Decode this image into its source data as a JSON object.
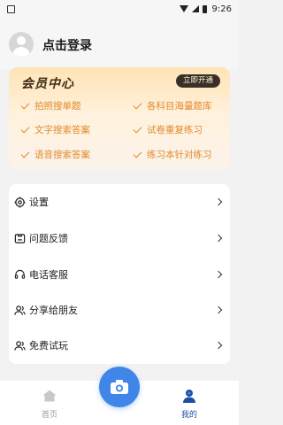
{
  "status_bar": {
    "app_icon": "a-notification-icon",
    "time": "9:26"
  },
  "header": {
    "login_label": "点击登录"
  },
  "vip": {
    "title": "会员中心",
    "open_button": "立即开通",
    "features": [
      "拍照搜单题",
      "各科目海量题库",
      "文字搜索答案",
      "试卷重复练习",
      "语音搜索答案",
      "练习本针对练习"
    ],
    "accent": "#e08a2c"
  },
  "menu": {
    "items": [
      {
        "label": "设置",
        "icon": "gear-icon"
      },
      {
        "label": "问题反馈",
        "icon": "feedback-icon"
      },
      {
        "label": "电话客服",
        "icon": "headset-icon"
      },
      {
        "label": "分享给朋友",
        "icon": "share-users-icon"
      },
      {
        "label": "免费试玩",
        "icon": "trial-user-icon"
      }
    ]
  },
  "tabbar": {
    "home_label": "首页",
    "mine_label": "我的",
    "active_color": "#1f4fa0",
    "inactive_color": "#9a9a9a"
  },
  "camera": {
    "icon": "camera-icon",
    "color": "#3f86e8"
  }
}
